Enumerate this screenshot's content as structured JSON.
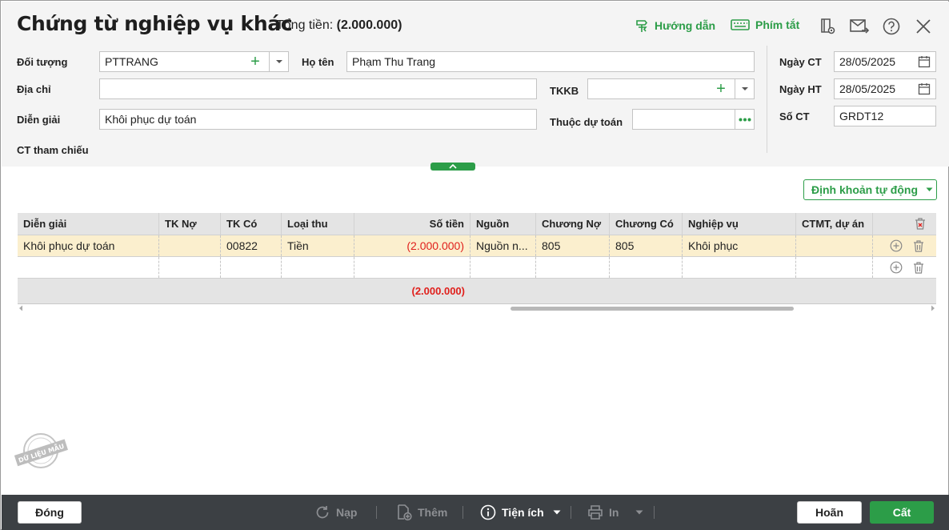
{
  "header": {
    "title": "Chứng từ nghiệp vụ khác",
    "total_label": "Tổng tiền:",
    "total_value": "(2.000.000)",
    "help_label": "Hướng dẫn",
    "shortcut_label": "Phím tắt"
  },
  "form": {
    "doi_tuong_label": "Đối tượng",
    "doi_tuong_value": "PTTRANG",
    "ho_ten_label": "Họ tên",
    "ho_ten_value": "Phạm Thu Trang",
    "dia_chi_label": "Địa chỉ",
    "dia_chi_value": "",
    "tkkb_label": "TKKB",
    "tkkb_value": "",
    "dien_giai_label": "Diễn giải",
    "dien_giai_value": "Khôi phục dự toán",
    "thuoc_du_toan_label": "Thuộc dự toán",
    "thuoc_du_toan_value": "",
    "ct_tham_chieu_label": "CT tham chiếu",
    "ngay_ct_label": "Ngày CT",
    "ngay_ct_value": "28/05/2025",
    "ngay_ht_label": "Ngày HT",
    "ngay_ht_value": "28/05/2025",
    "so_ct_label": "Số CT",
    "so_ct_value": "GRDT12"
  },
  "auto_button": "Định khoản tự động",
  "grid": {
    "columns": [
      "Diễn giải",
      "TK Nợ",
      "TK Có",
      "Loại thu",
      "Số tiền",
      "Nguồn",
      "Chương Nợ",
      "Chương Có",
      "Nghiệp vụ",
      "CTMT, dự án"
    ],
    "rows": [
      [
        "Khôi phục dự toán",
        "",
        "00822",
        "Tiền",
        "(2.000.000)",
        "Nguồn n...",
        "805",
        "805",
        "Khôi phục",
        ""
      ],
      [
        "",
        "",
        "",
        "",
        "",
        "",
        "",
        "",
        "",
        ""
      ]
    ],
    "total": "(2.000.000)"
  },
  "watermark": "DỮ LIỆU MẪU",
  "footer": {
    "close": "Đóng",
    "reload": "Nạp",
    "add": "Thêm",
    "utilities": "Tiện ích",
    "print": "In",
    "cancel": "Hoãn",
    "save": "Cất"
  },
  "colors": {
    "accent": "#2c9d48",
    "negative": "#e0201c",
    "selected_row": "#fbefce",
    "footer_bg": "#3c4044"
  }
}
